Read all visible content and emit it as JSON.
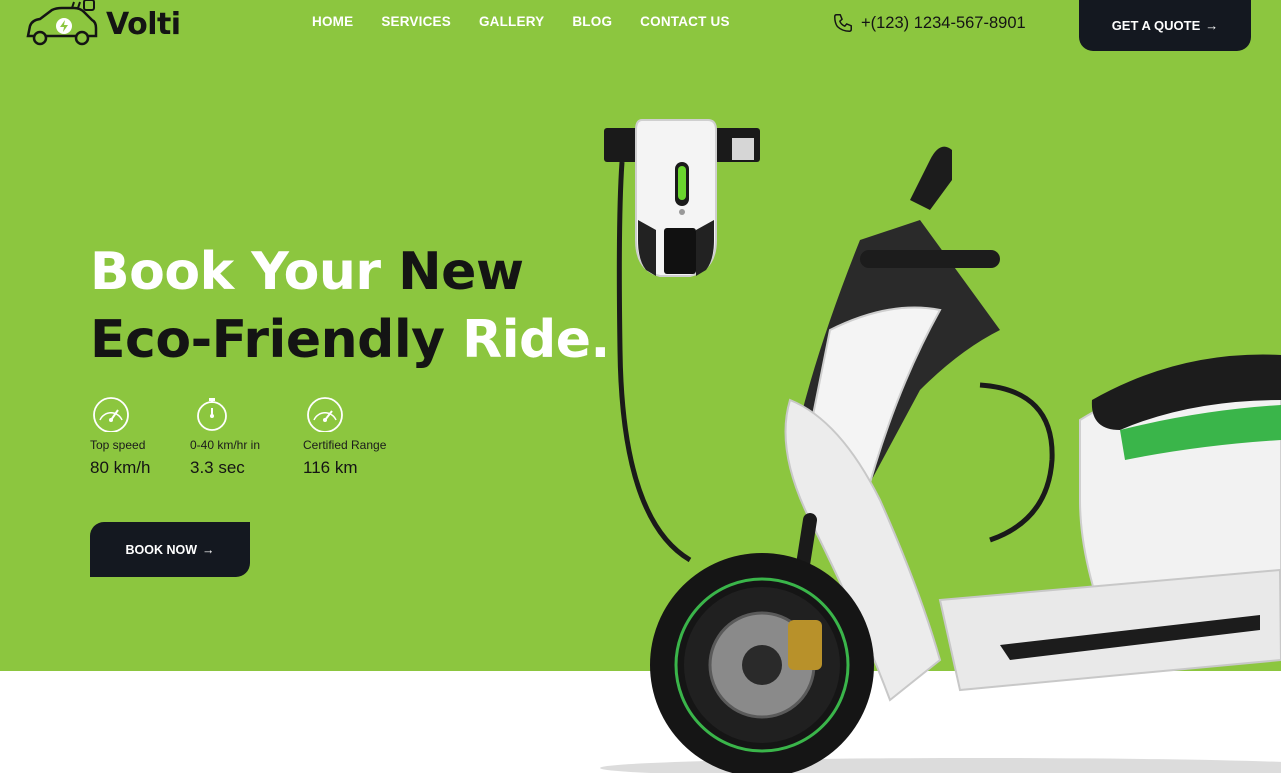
{
  "brand": {
    "name": "Volti",
    "logo_icon": "electric-car-plug-logo"
  },
  "nav": {
    "items": [
      {
        "label": "HOME"
      },
      {
        "label": "SERVICES"
      },
      {
        "label": "GALLERY"
      },
      {
        "label": "BLOG"
      },
      {
        "label": "CONTACT US"
      }
    ]
  },
  "header": {
    "phone": "+(123) 1234-567-8901",
    "phone_icon": "phone-icon",
    "quote_label": "GET A QUOTE",
    "arrow": "→"
  },
  "hero": {
    "line1": {
      "part_white": "Book Your ",
      "part_dark": "New"
    },
    "line2": {
      "part_dark": "Eco-Friendly ",
      "part_white": "Ride."
    },
    "stats": [
      {
        "icon": "speedometer-icon",
        "label": "Top speed",
        "value": "80 km/h"
      },
      {
        "icon": "stopwatch-icon",
        "label": "0-40 km/hr in",
        "value": "3.3 sec"
      },
      {
        "icon": "gauge-icon",
        "label": "Certified Range",
        "value": "116 km"
      }
    ],
    "book_label": "BOOK NOW",
    "arrow": "→"
  },
  "colors": {
    "hero_green": "#8cc63f",
    "dark": "#141820",
    "text_dark": "#141414",
    "white": "#ffffff",
    "accent_green": "#39b54a"
  }
}
